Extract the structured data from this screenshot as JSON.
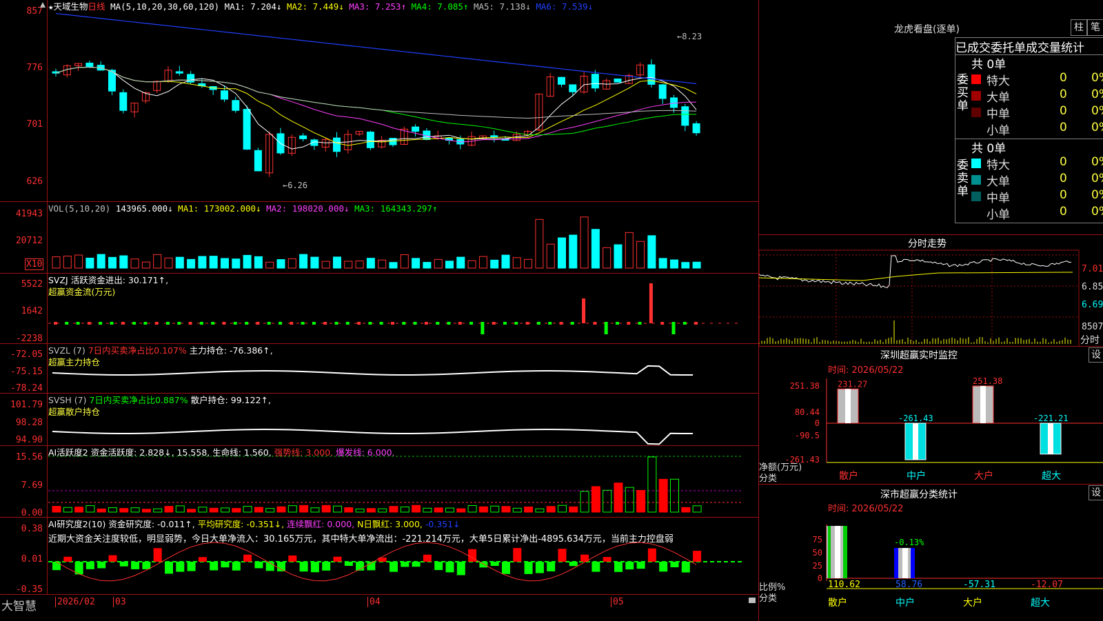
{
  "kline": {
    "star": "★",
    "stock_name": "天域生物",
    "period": "日线",
    "ma_param": "MA(5,10,20,30,60,120)",
    "ma1": "MA1: 7.204↓",
    "ma2": "MA2: 7.449↓",
    "ma3": "MA3: 7.253↑",
    "ma4": "MA4: 7.085↑",
    "ma5": "MA5: 7.138↓",
    "ma6": "MA6: 7.539↓",
    "yticks": [
      "857",
      "776",
      "701",
      "626"
    ],
    "high_label": "8.23",
    "low_label": "6.26"
  },
  "vol": {
    "title": "VOL(5,10,20)",
    "value": "143965.000↓",
    "ma1": "MA1: 173002.000↓",
    "ma2": "MA2: 198020.000↓",
    "ma3": "MA3: 164343.297↑",
    "yticks": [
      "41943",
      "20712"
    ],
    "unit": "X10"
  },
  "svzj": {
    "title": "SVZJ  活跃资金进出: 30.171↑,",
    "subtitle": "超赢资金流(万元)",
    "yticks": [
      "5522",
      "1642",
      "-2238"
    ]
  },
  "svzl": {
    "title": "SVZL (7)",
    "ratio": "7日内买卖净占比0.107%",
    "hold": "主力持仓: -76.386↑,",
    "subtitle": "超赢主力持仓",
    "yticks": [
      "-72.05",
      "-75.15",
      "-78.24"
    ]
  },
  "svsh": {
    "title": "SVSH (7)",
    "ratio": "7日内买卖净占比0.887%",
    "hold": "散户持仓: 99.122↑,",
    "subtitle": "超赢散户持仓",
    "yticks": [
      "101.79",
      "98.28",
      "94.90"
    ]
  },
  "ai_active": {
    "title": "AI活跃度2 资金活跃度: 2.828↓, 15.558,",
    "life": "生命线: 1.560,",
    "strong": "强势线: 3.000,",
    "burst": "爆发线: 6.000,",
    "yticks": [
      "15.56",
      "7.69",
      "0.00"
    ]
  },
  "ai_research": {
    "title": "AI研究度2(10) 资金研究度: -0.011↑,",
    "avg": "平均研究度: -0.351↓,",
    "cont": "连续飘红: 0.000,",
    "nday": "N日飘红: 3.000,",
    "last": "-0.351↓",
    "comment": "近期大资金关注度较低，明显弱势，今日大单净流入：30.165万元，其中特大单净流出：-221.214万元，大单5日累计净出-4895.634万元，当前主力控盘弱",
    "yticks": [
      "0.38",
      "0.01",
      "-0.35"
    ]
  },
  "footer": {
    "brand": "大智慧",
    "months": [
      "2026/02",
      "03",
      "04",
      "05"
    ]
  },
  "longhu": {
    "title": "龙虎看盘(逐单)",
    "btn1": "柱",
    "btn2": "笔",
    "tabs": [
      "已成交",
      "委托单",
      "成交量统计"
    ],
    "buy": {
      "vertical": "委买单",
      "total": "共 0单",
      "rows": [
        {
          "label": "特大",
          "count": "0",
          "pct": "0%",
          "color": "#ff0000"
        },
        {
          "label": "大单",
          "count": "0",
          "pct": "0%",
          "color": "#a00000"
        },
        {
          "label": "中单",
          "count": "0",
          "pct": "0%",
          "color": "#600000"
        },
        {
          "label": "小单",
          "count": "0",
          "pct": "0%",
          "color": "#000000"
        }
      ]
    },
    "sell": {
      "vertical": "委卖单",
      "total": "共 0单",
      "rows": [
        {
          "label": "特大",
          "count": "0",
          "pct": "0%",
          "color": "#00ffff"
        },
        {
          "label": "大单",
          "count": "0",
          "pct": "0%",
          "color": "#009090"
        },
        {
          "label": "中单",
          "count": "0",
          "pct": "0%",
          "color": "#006060"
        },
        {
          "label": "小单",
          "count": "0",
          "pct": "0%",
          "color": "#000000"
        }
      ]
    }
  },
  "fenshi": {
    "title": "分时走势",
    "yticks": [
      "7.01",
      "6.85",
      "6.69"
    ],
    "vol_label": "8507",
    "unit": "分时"
  },
  "sz_monitor": {
    "title": "深圳超赢实时监控",
    "setting": "设",
    "time": "时间: 2026/05/22",
    "yticks": [
      "251.38",
      "80.44",
      "0",
      "-90.5",
      "-261.43"
    ],
    "ylabel": "净额(万元)",
    "xlabel": "分类",
    "chart_data": {
      "type": "bar",
      "categories": [
        "散户",
        "中户",
        "大户",
        "超大"
      ],
      "values": [
        231.27,
        -261.43,
        251.38,
        -221.21
      ],
      "value_labels": [
        "231.27",
        "-261.43",
        "251.38",
        "-221.21"
      ],
      "ylim": [
        -261.43,
        251.38
      ]
    }
  },
  "sz_stat": {
    "title": "深市超赢分类统计",
    "setting": "设",
    "time": "时间: 2026/05/22",
    "yticks": [
      "75",
      "50",
      "25",
      "0"
    ],
    "ylabel": "比例%",
    "xlabel": "分类",
    "bar_label": "-0.13%",
    "chart_data": {
      "type": "bar",
      "categories": [
        "散户",
        "中户",
        "大户",
        "超大"
      ],
      "values": [
        110.62,
        58.76,
        -57.31,
        -12.07
      ],
      "value_labels": [
        "110.62",
        "58.76",
        "-57.31",
        "-12.07"
      ],
      "ylim": [
        0,
        75
      ]
    }
  },
  "colors": {
    "up": "#ff3030",
    "down": "#00ffff",
    "grid": "#a01010",
    "ma1": "#ffffff",
    "ma2": "#ffff00",
    "ma3": "#ff40ff",
    "ma4": "#00ff00",
    "ma5": "#c0c0c0",
    "ma6": "#2040ff"
  }
}
